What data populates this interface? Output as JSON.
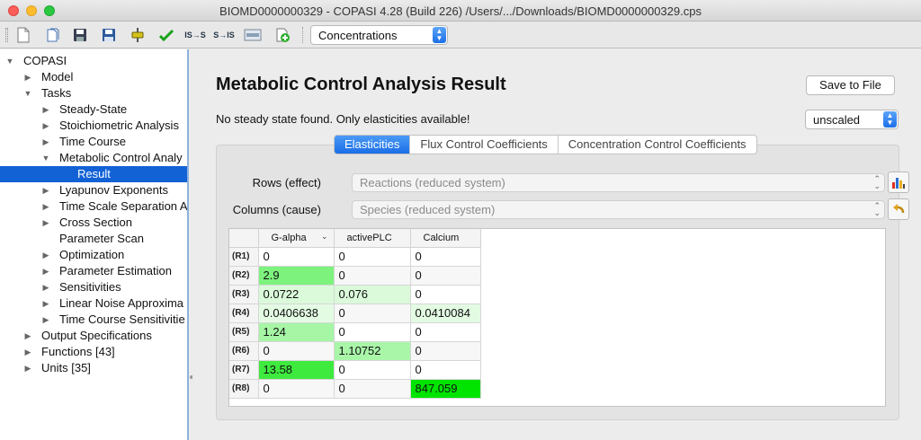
{
  "window": {
    "title": "BIOMD0000000329 - COPASI 4.28 (Build 226) /Users/.../Downloads/BIOMD0000000329.cps"
  },
  "toolbar": {
    "icons": [
      "new-document-icon",
      "open-icon",
      "save-icon",
      "save-as-icon",
      "slider-icon",
      "check-icon",
      "is-s-icon",
      "s-is-icon",
      "sbml-icon",
      "add-icon"
    ],
    "is_s_label": "IS→S",
    "s_is_label": "S→IS",
    "combo_value": "Concentrations"
  },
  "tree": {
    "items": [
      {
        "label": "COPASI",
        "arrow": "down",
        "level": 0
      },
      {
        "label": "Model",
        "arrow": "right",
        "level": 1
      },
      {
        "label": "Tasks",
        "arrow": "down",
        "level": 1
      },
      {
        "label": "Steady-State",
        "arrow": "right",
        "level": 2
      },
      {
        "label": "Stoichiometric Analysis",
        "arrow": "right",
        "level": 2
      },
      {
        "label": "Time Course",
        "arrow": "right",
        "level": 2
      },
      {
        "label": "Metabolic Control Analy",
        "arrow": "down",
        "level": 2
      },
      {
        "label": "Result",
        "arrow": "",
        "level": 3,
        "selected": true
      },
      {
        "label": "Lyapunov Exponents",
        "arrow": "right",
        "level": 2
      },
      {
        "label": "Time Scale Separation A",
        "arrow": "right",
        "level": 2
      },
      {
        "label": "Cross Section",
        "arrow": "right",
        "level": 2
      },
      {
        "label": "Parameter Scan",
        "arrow": "",
        "level": 2
      },
      {
        "label": "Optimization",
        "arrow": "right",
        "level": 2
      },
      {
        "label": "Parameter Estimation",
        "arrow": "right",
        "level": 2
      },
      {
        "label": "Sensitivities",
        "arrow": "right",
        "level": 2
      },
      {
        "label": "Linear Noise Approxima",
        "arrow": "right",
        "level": 2
      },
      {
        "label": "Time Course Sensitivitie",
        "arrow": "right",
        "level": 2
      },
      {
        "label": "Output Specifications",
        "arrow": "right",
        "level": 1
      },
      {
        "label": "Functions [43]",
        "arrow": "right",
        "level": 1
      },
      {
        "label": "Units [35]",
        "arrow": "right",
        "level": 1
      }
    ]
  },
  "main": {
    "title": "Metabolic Control Analysis Result",
    "save_button": "Save to File",
    "notice": "No steady state found. Only elasticities available!",
    "scaling_value": "unscaled",
    "tabs": [
      {
        "label": "Elasticities",
        "active": true
      },
      {
        "label": "Flux Control Coefficients",
        "active": false
      },
      {
        "label": "Concentration Control Coefficients",
        "active": false
      }
    ],
    "rows_label": "Rows (effect)",
    "rows_value": "Reactions (reduced system)",
    "columns_label": "Columns (cause)",
    "columns_value": "Species (reduced system)",
    "table": {
      "columns": [
        "G-alpha",
        "activePLC",
        "Calcium"
      ],
      "sorted_column": "G-alpha",
      "rows": [
        {
          "label": "(R1)",
          "cells": [
            "0",
            "0",
            "0"
          ],
          "shade": [
            "",
            "",
            ""
          ]
        },
        {
          "label": "(R2)",
          "cells": [
            "2.9",
            "0",
            "0"
          ],
          "shade": [
            "#7df27d",
            "",
            ""
          ]
        },
        {
          "label": "(R3)",
          "cells": [
            "0.0722",
            "0.076",
            "0"
          ],
          "shade": [
            "#dafada",
            "#dafada",
            ""
          ]
        },
        {
          "label": "(R4)",
          "cells": [
            "0.0406638",
            "0",
            "0.0410084"
          ],
          "shade": [
            "#e3fbe3",
            "",
            "#e3fbe3"
          ]
        },
        {
          "label": "(R5)",
          "cells": [
            "1.24",
            "0",
            "0"
          ],
          "shade": [
            "#a6f6a6",
            "",
            ""
          ]
        },
        {
          "label": "(R6)",
          "cells": [
            "0",
            "1.10752",
            "0"
          ],
          "shade": [
            "",
            "#a9f6a9",
            ""
          ]
        },
        {
          "label": "(R7)",
          "cells": [
            "13.58",
            "0",
            "0"
          ],
          "shade": [
            "#3fea3f",
            "",
            ""
          ]
        },
        {
          "label": "(R8)",
          "cells": [
            "0",
            "0",
            "847.059"
          ],
          "shade": [
            "",
            "",
            "#00e400"
          ]
        }
      ]
    }
  }
}
